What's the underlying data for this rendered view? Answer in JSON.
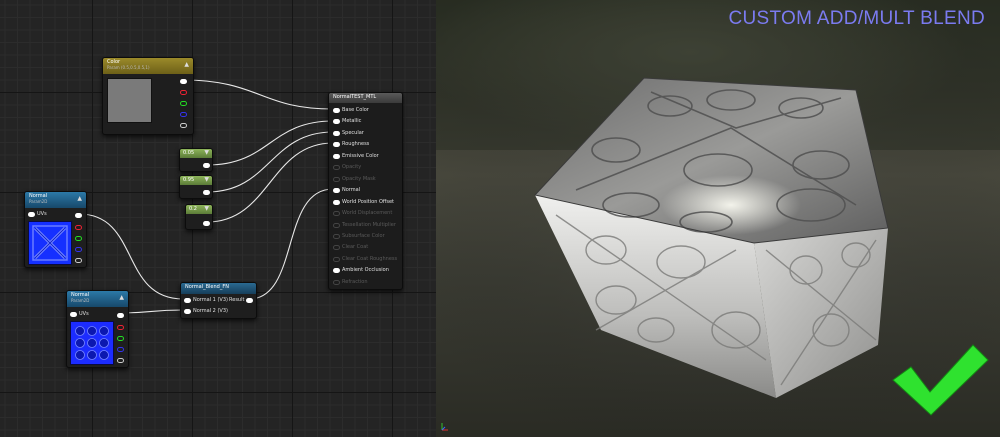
{
  "viewport": {
    "title": "CUSTOM ADD/MULT BLEND",
    "checkmark_color": "#2fe22f",
    "title_color": "#7b7bf0"
  },
  "nodes": {
    "color": {
      "title": "Color",
      "subtitle": "Param (0.5,0.5,0.5,1)",
      "header_color": "#8a7a1e"
    },
    "scalar1": {
      "value": "0.05"
    },
    "scalar2": {
      "value": "0.95"
    },
    "scalar3": {
      "value": "0.2"
    },
    "normal1": {
      "title": "Normal",
      "subtitle": "Param2D",
      "uvs_label": "UVs",
      "header_color": "#1f5f8a"
    },
    "normal2": {
      "title": "Normal",
      "subtitle": "Param2D",
      "uvs_label": "UVs",
      "header_color": "#1f5f8a"
    },
    "blend": {
      "title": "Normal_Blend_FN",
      "input1": "Normal 1 (V3)",
      "input2": "Normal 2 (V3)",
      "output": "Result",
      "header_color": "#1e4f6e"
    },
    "material": {
      "title": "NormalTEST_MTL",
      "header_color": "#4a4a4a",
      "inputs": [
        {
          "label": "Base Color",
          "active": true
        },
        {
          "label": "Metallic",
          "active": true
        },
        {
          "label": "Specular",
          "active": true
        },
        {
          "label": "Roughness",
          "active": true
        },
        {
          "label": "Emissive Color",
          "active": true
        },
        {
          "label": "Opacity",
          "active": false
        },
        {
          "label": "Opacity Mask",
          "active": false
        },
        {
          "label": "Normal",
          "active": true
        },
        {
          "label": "World Position Offset",
          "active": true
        },
        {
          "label": "World Displacement",
          "active": false
        },
        {
          "label": "Tessellation Multiplier",
          "active": false
        },
        {
          "label": "Subsurface Color",
          "active": false
        },
        {
          "label": "Clear Coat",
          "active": false
        },
        {
          "label": "Clear Coat Roughness",
          "active": false
        },
        {
          "label": "Ambient Occlusion",
          "active": true
        },
        {
          "label": "Refraction",
          "active": false
        }
      ]
    }
  }
}
